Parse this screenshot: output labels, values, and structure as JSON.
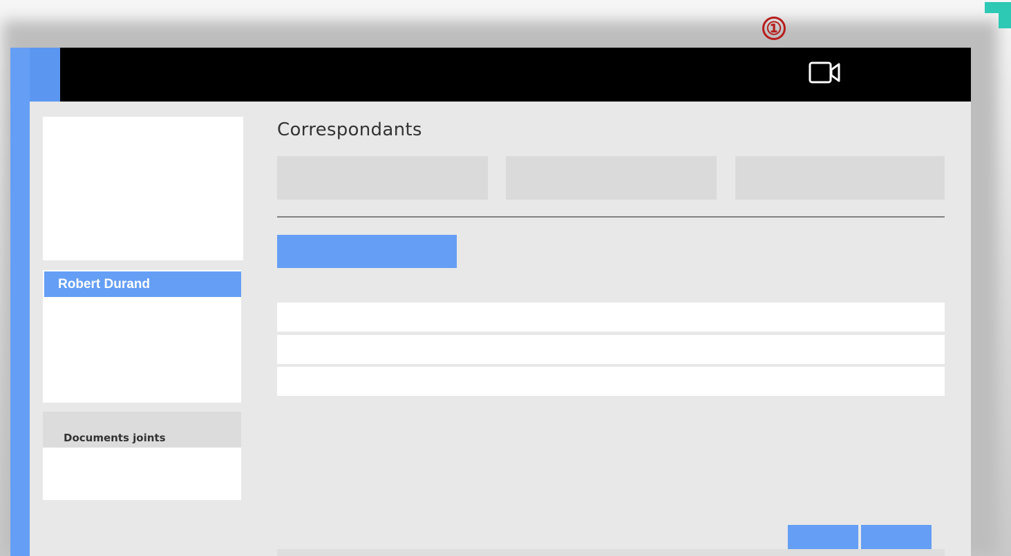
{
  "annotation": {
    "marker": "①"
  },
  "header": {
    "video_icon": "video-camera-icon"
  },
  "sidebar": {
    "contact_name": "Robert Durand",
    "documents_label": "Documents joints"
  },
  "main": {
    "title": "Correspondants"
  },
  "colors": {
    "accent_blue": "#659ef5",
    "top_bar": "#000000",
    "panel_bg": "#e8e8e8",
    "annotation_red": "#b71c1c",
    "corner_teal": "#2dc9b5"
  }
}
